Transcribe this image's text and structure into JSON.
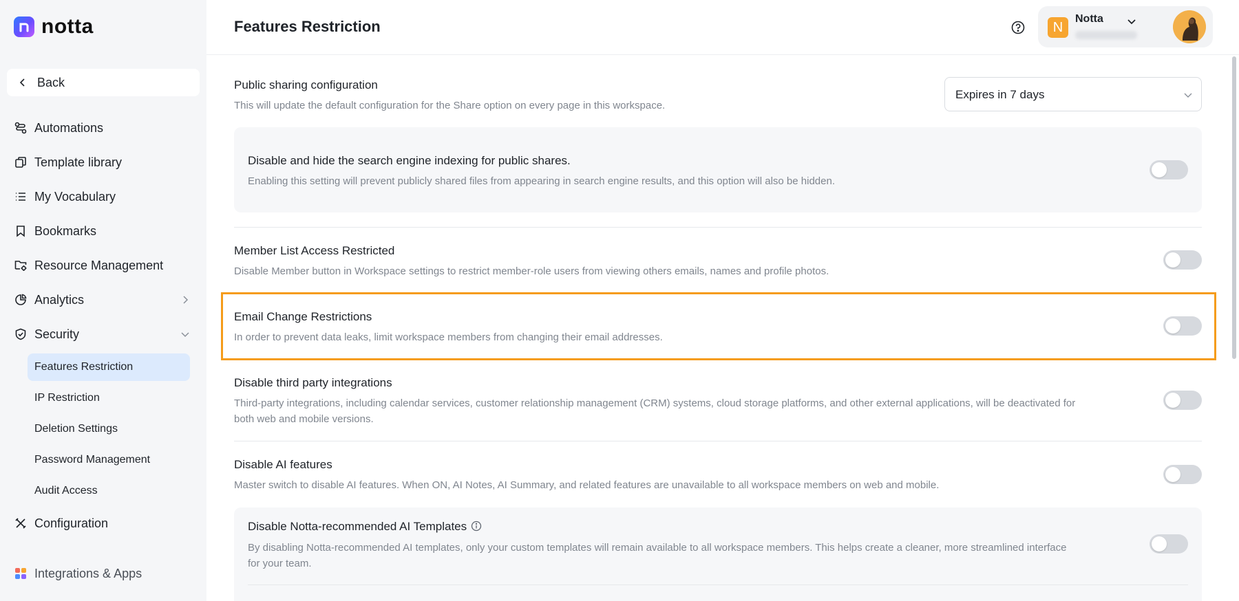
{
  "app": {
    "logo_text": "notta"
  },
  "sidebar": {
    "back_label": "Back",
    "items": [
      {
        "label": "Automations",
        "icon": "automations-icon"
      },
      {
        "label": "Template library",
        "icon": "template-icon"
      },
      {
        "label": "My Vocabulary",
        "icon": "list-icon"
      },
      {
        "label": "Bookmarks",
        "icon": "bookmark-icon"
      },
      {
        "label": "Resource Management",
        "icon": "folder-settings-icon"
      },
      {
        "label": "Analytics",
        "icon": "pie-chart-icon"
      },
      {
        "label": "Security",
        "icon": "shield-icon"
      },
      {
        "label": "Configuration",
        "icon": "tools-icon"
      },
      {
        "label": "Integrations & Apps",
        "icon": "apps-grid-icon"
      }
    ],
    "security_sub": [
      {
        "label": "Features Restriction",
        "active": true
      },
      {
        "label": "IP Restriction",
        "active": false
      },
      {
        "label": "Deletion Settings",
        "active": false
      },
      {
        "label": "Password Management",
        "active": false
      },
      {
        "label": "Audit Access",
        "active": false
      }
    ]
  },
  "header": {
    "title": "Features Restriction",
    "workspace_badge": "N",
    "workspace_name": "Notta"
  },
  "settings": {
    "public_sharing": {
      "title": "Public sharing configuration",
      "desc": "This will update the default configuration for the Share option on every page in this workspace.",
      "select_value": "Expires in 7 days"
    },
    "search_indexing": {
      "title": "Disable and hide the search engine indexing for public shares.",
      "desc": "Enabling this setting will prevent publicly shared files from appearing in search engine results, and this option will also be hidden.",
      "enabled": false
    },
    "member_list": {
      "title": "Member List Access Restricted",
      "desc": "Disable Member button in Workspace settings to restrict member-role users from viewing others emails, names and profile photos.",
      "enabled": false
    },
    "email_change": {
      "title": "Email Change Restrictions",
      "desc": "In order to prevent data leaks, limit workspace members from changing their email addresses.",
      "enabled": false
    },
    "third_party": {
      "title": "Disable third party integrations",
      "desc_line1": "Third-party integrations, including calendar services, customer relationship management (CRM) systems, cloud storage platforms, and other external applications, will be deactivated for",
      "desc_line2": "both web and mobile versions.",
      "enabled": false
    },
    "ai_features": {
      "title": "Disable AI features",
      "desc": "Master switch to disable AI features. When ON, AI Notes, AI Summary, and related features are unavailable to all workspace members on web and mobile.",
      "enabled": false
    },
    "ai_templates": {
      "title": "Disable Notta-recommended AI Templates",
      "desc_line1": "By disabling Notta-recommended AI templates, only your custom templates will remain available to all workspace members. This helps create a cleaner, more streamlined interface",
      "desc_line2": "for your team.",
      "enabled": false
    }
  },
  "colors": {
    "accent_highlight": "#f59c1a",
    "active_nav_bg": "#dceafd",
    "toggle_off": "#d6d9de",
    "workspace_badge": "#f7a530"
  }
}
